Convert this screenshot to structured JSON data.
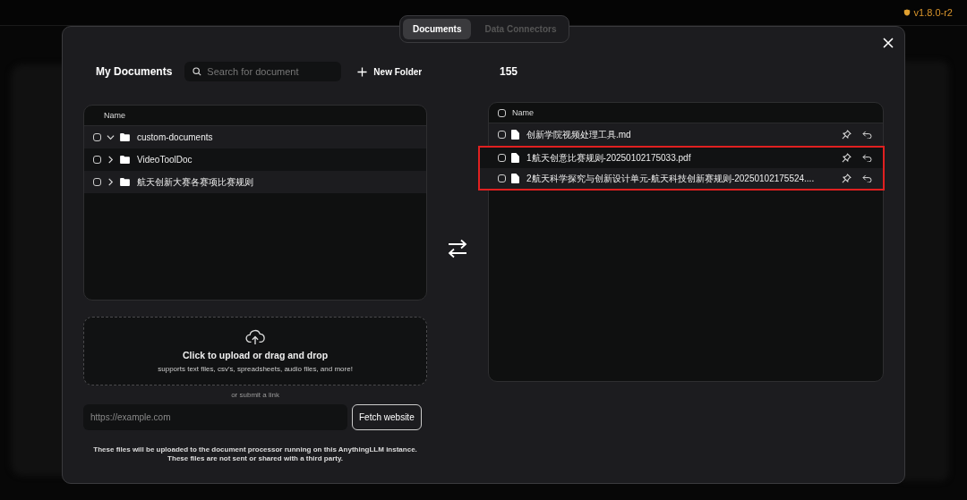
{
  "version": "v1.8.0-r2",
  "tabs": [
    {
      "label": "Documents",
      "selected": true
    },
    {
      "label": "Data Connectors",
      "selected": false
    }
  ],
  "my_documents": {
    "title": "My Documents",
    "search": {
      "placeholder": "Search for document"
    },
    "new_folder": "New Folder",
    "table": {
      "column": "Name",
      "rows": [
        {
          "name": "custom-documents",
          "checked": false,
          "expanded": true
        },
        {
          "name": "VideoToolDoc",
          "checked": false,
          "expanded": false
        },
        {
          "name": "航天创新大赛各赛项比赛规则",
          "checked": false,
          "expanded": false
        }
      ]
    }
  },
  "upload": {
    "title": "Click to upload or drag and drop",
    "subtitle": "supports text files, csv's, spreadsheets, audio files, and more!",
    "or_link": "or submit a link",
    "url_placeholder": "https://example.com",
    "fetch_button": "Fetch website",
    "notice": [
      "These files will be uploaded to the document processor running on this AnythingLLM instance.",
      "These files are not sent or shared with a third party."
    ]
  },
  "workspace": {
    "title": "155",
    "table": {
      "column": "Name",
      "checked": false,
      "rows": [
        {
          "name": "创新学院视频处理工具.md",
          "checked": false,
          "highlighted": false
        },
        {
          "name": "1航天创意比赛规则-20250102175033.pdf",
          "checked": false,
          "highlighted": true
        },
        {
          "name": "2航天科学探究与创新设计单元-航天科技创新赛规则-20250102175524....",
          "checked": false,
          "highlighted": true
        }
      ]
    }
  }
}
